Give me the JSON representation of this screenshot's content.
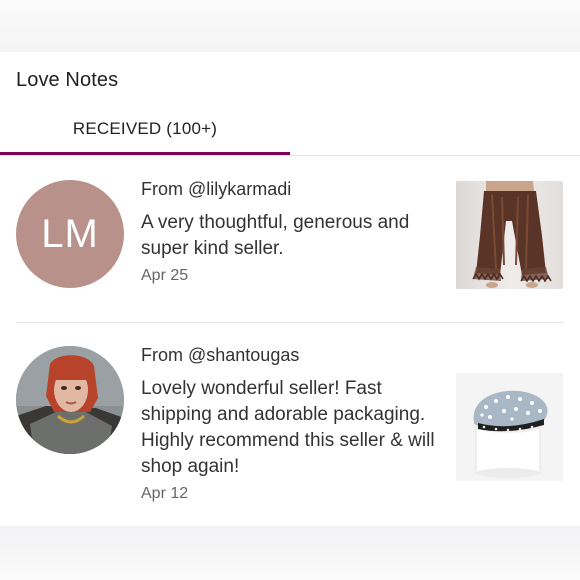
{
  "header": {
    "title": "Love Notes"
  },
  "tabs": [
    {
      "label": "RECEIVED (100+)",
      "active": true
    }
  ],
  "accent_color": "#7f0353",
  "notes": [
    {
      "avatar_initials": "LM",
      "avatar_color": "#b9918b",
      "from": "From @lilykarmadi",
      "message": "A very thoughtful, generous and super kind seller.",
      "date": "Apr 25",
      "thumbnail": "brown-pants-photo"
    },
    {
      "avatar_initials": "",
      "avatar_image": "user-profile-photo",
      "from": "From @shantougas",
      "message": "Lovely wonderful seller! Fast shipping and adorable packaging. Highly recommend this seller & will shop again!",
      "date": "Apr 12",
      "thumbnail": "embellished-beret-photo"
    }
  ]
}
